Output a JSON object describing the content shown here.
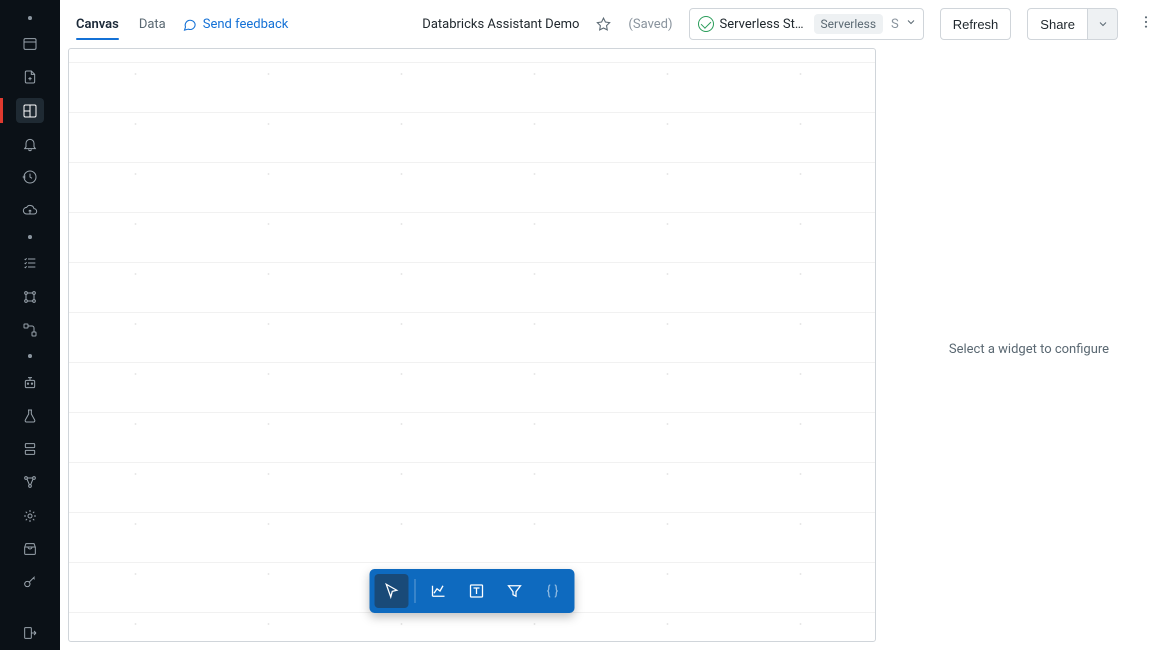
{
  "header": {
    "tabs": [
      {
        "id": "canvas",
        "label": "Canvas",
        "active": true
      },
      {
        "id": "data",
        "label": "Data",
        "active": false
      }
    ],
    "feedback_label": "Send feedback",
    "title": "Databricks Assistant Demo",
    "saved_label": "(Saved)",
    "cluster": {
      "name": "Serverless Sta…",
      "chip": "Serverless",
      "type_short": "S",
      "status": "running"
    },
    "buttons": {
      "refresh": "Refresh",
      "share": "Share"
    }
  },
  "right_panel": {
    "placeholder": "Select a widget to configure"
  },
  "float_toolbar": {
    "tools": [
      {
        "id": "cursor",
        "icon": "cursor-icon",
        "active": true
      },
      {
        "id": "chart",
        "icon": "chart-line-icon",
        "active": false
      },
      {
        "id": "text",
        "icon": "text-box-icon",
        "active": false
      },
      {
        "id": "filter",
        "icon": "funnel-icon",
        "active": false
      },
      {
        "id": "code",
        "icon": "curly-braces-icon",
        "active": false,
        "dim": true
      }
    ]
  },
  "left_rail": {
    "groups": [
      [
        "window-icon",
        "file-plus-icon",
        "dashboard-icon",
        "bell-icon",
        "history-icon",
        "cloud-up-icon"
      ],
      [
        "checklist-icon",
        "pipeline-icon",
        "flowchart-icon"
      ],
      [
        "robot-icon",
        "flask-icon",
        "stack-icon",
        "genome-icon",
        "ml-icon"
      ],
      [
        "store-icon",
        "key-icon"
      ],
      [
        "logout-icon"
      ]
    ],
    "active": "dashboard-icon"
  }
}
